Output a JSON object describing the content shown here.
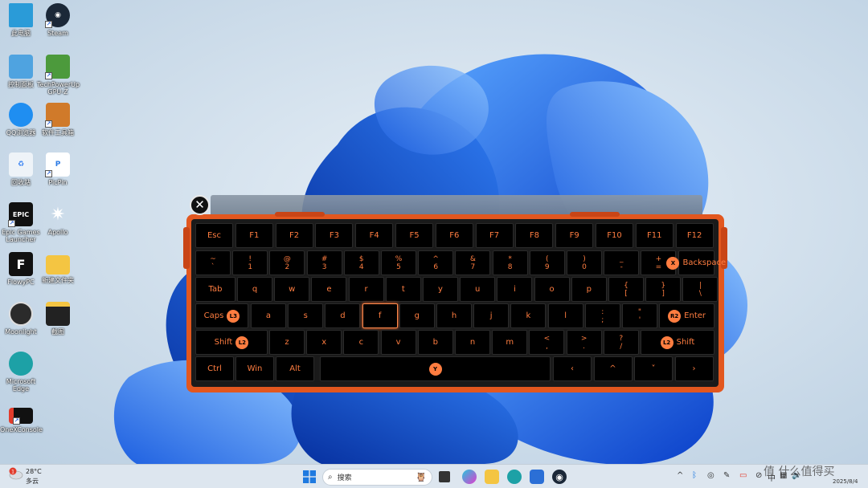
{
  "desktop": {
    "icons": [
      {
        "label": "此电脑"
      },
      {
        "label": "Steam"
      },
      {
        "label": "控制面板"
      },
      {
        "label": "TechPowerUp GPU-Z"
      },
      {
        "label": "QQ浏览器"
      },
      {
        "label": "软件工具箱"
      },
      {
        "label": "回收站"
      },
      {
        "label": "PicPin"
      },
      {
        "label": "Epic Games Launcher"
      },
      {
        "label": "Apollo"
      },
      {
        "label": "FlowyPC"
      },
      {
        "label": "新建文件夹"
      },
      {
        "label": "Moonlight"
      },
      {
        "label": "截图"
      },
      {
        "label": "Microsoft Edge"
      },
      {
        "label": "OneXConsole"
      }
    ]
  },
  "keyboard": {
    "close_icon": "close-icon",
    "row1": [
      "Esc",
      "F1",
      "F2",
      "F3",
      "F4",
      "F5",
      "F6",
      "F7",
      "F8",
      "F9",
      "F10",
      "F11",
      "F12"
    ],
    "row2": [
      {
        "top": "~",
        "bottom": "`"
      },
      {
        "top": "!",
        "bottom": "1"
      },
      {
        "top": "@",
        "bottom": "2"
      },
      {
        "top": "#",
        "bottom": "3"
      },
      {
        "top": "$",
        "bottom": "4"
      },
      {
        "top": "%",
        "bottom": "5"
      },
      {
        "top": "^",
        "bottom": "6"
      },
      {
        "top": "&",
        "bottom": "7"
      },
      {
        "top": "*",
        "bottom": "8"
      },
      {
        "top": "(",
        "bottom": "9"
      },
      {
        "top": ")",
        "bottom": "0"
      },
      {
        "top": "_",
        "bottom": "-"
      },
      {
        "top": "+",
        "bottom": "="
      }
    ],
    "backspace": {
      "label": "Backspace",
      "badge": "X"
    },
    "row3": {
      "tab": "Tab",
      "letters": [
        "q",
        "w",
        "e",
        "r",
        "t",
        "y",
        "u",
        "i",
        "o",
        "p"
      ],
      "symbols": [
        {
          "top": "{",
          "bottom": "["
        },
        {
          "top": "}",
          "bottom": "]"
        },
        {
          "top": "|",
          "bottom": "\\"
        }
      ]
    },
    "row4": {
      "caps": {
        "label": "Caps",
        "badge": "L3"
      },
      "letters": [
        "a",
        "s",
        "d",
        "f",
        "g",
        "h",
        "j",
        "k",
        "l"
      ],
      "symbols": [
        {
          "top": ":",
          "bottom": ";"
        },
        {
          "top": "\"",
          "bottom": "'"
        }
      ],
      "enter": {
        "label": "Enter",
        "badge": "R2"
      },
      "selected": "f"
    },
    "row5": {
      "shift_left": {
        "label": "Shift",
        "badge": "L2"
      },
      "letters": [
        "z",
        "x",
        "c",
        "v",
        "b",
        "n",
        "m"
      ],
      "symbols": [
        {
          "top": "<",
          "bottom": ","
        },
        {
          "top": ">",
          "bottom": "."
        },
        {
          "top": "?",
          "bottom": "/"
        }
      ],
      "shift_right": {
        "label": "Shift",
        "badge": "L2"
      }
    },
    "row6": {
      "ctrl": "Ctrl",
      "win": "Win",
      "alt": "Alt",
      "space_badge": "Y",
      "arrows": [
        "‹",
        "^",
        "˅",
        "›"
      ]
    }
  },
  "taskbar": {
    "weather": {
      "temp": "28°C",
      "desc": "多云",
      "alert": "1"
    },
    "search_placeholder": "搜索",
    "tray": {
      "lang": "中",
      "date": "2025/8/4"
    },
    "watermark": "值 什么值得买"
  }
}
